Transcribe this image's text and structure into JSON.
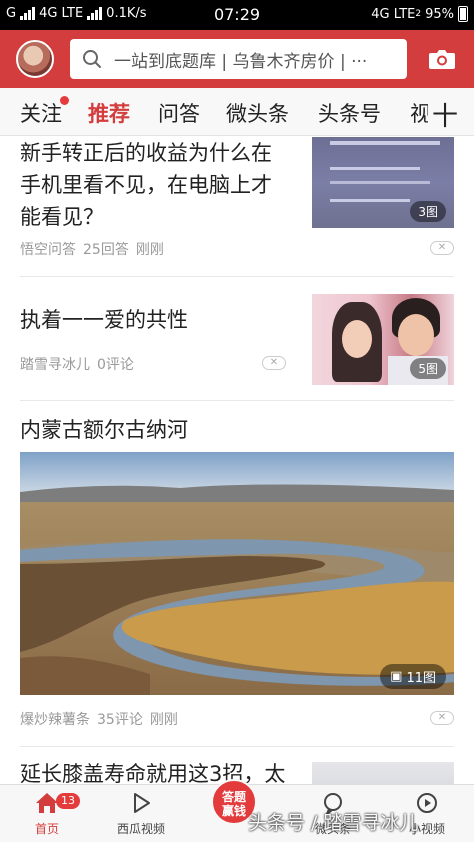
{
  "status_bar": {
    "carrier": "G",
    "network_left": "4G LTE",
    "speed": "0.1K/s",
    "time": "07:29",
    "network_right": "4G LTE",
    "network_right_sub": "2",
    "battery": "95%"
  },
  "header": {
    "search_placeholder": "一站到底题库 | 乌鲁木齐房价 | ···",
    "search_icon": "search-icon",
    "camera_icon": "camera-icon",
    "accent_color": "#d43d3d"
  },
  "tabs": [
    {
      "label": "关注",
      "badge_dot": true
    },
    {
      "label": "推荐",
      "active": true
    },
    {
      "label": "问答"
    },
    {
      "label": "微头条"
    },
    {
      "label": "头条号"
    },
    {
      "label": "视"
    }
  ],
  "tabs_more_label": "十",
  "feed": {
    "items": [
      {
        "title": "新手转正后的收益为什么在手机里看不见，在电脑上才能看见？",
        "meta": [
          "悟空问答",
          "25回答",
          "刚刚"
        ],
        "image_count": "3图"
      },
      {
        "title": "执着一一爱的共性",
        "meta": [
          "踏雪寻冰儿",
          "0评论"
        ],
        "image_count": "5图"
      },
      {
        "title": "内蒙古额尔古纳河",
        "meta": [
          "爆炒辣薯条",
          "35评论",
          "刚刚"
        ],
        "image_count": "11图"
      },
      {
        "title": "延长膝盖寿命就用这3招，太"
      }
    ]
  },
  "bottom_nav": {
    "home": {
      "label": "首页",
      "badge": "13"
    },
    "video": {
      "label": "西瓜视频"
    },
    "answer": {
      "label": "答题赢钱"
    },
    "micro": {
      "label": "微头条"
    },
    "small_video": {
      "label": "小视频"
    }
  },
  "watermark": "头条号 / 踏雪寻冰儿"
}
